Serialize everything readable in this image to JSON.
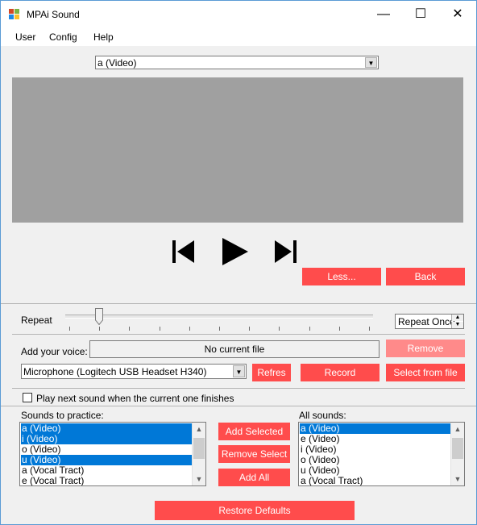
{
  "window": {
    "title": "MPAi Sound",
    "minimize": "—",
    "maximize": "☐",
    "close": "✕"
  },
  "menu": {
    "user": "User",
    "config": "Config",
    "help": "Help"
  },
  "video_select": {
    "value": "a (Video)"
  },
  "transport": {
    "prev": "skip-back",
    "play": "play",
    "next": "skip-forward"
  },
  "buttons": {
    "less": "Less...",
    "back": "Back",
    "remove": "Remove",
    "refresh": "Refres",
    "record": "Record",
    "select_from_file": "Select from file",
    "add_selected": "Add Selected",
    "remove_select": "Remove Select",
    "add_all": "Add All",
    "restore_defaults": "Restore Defaults"
  },
  "repeat": {
    "label": "Repeat",
    "slider_value_fraction": 0.1,
    "mode": "Repeat Once"
  },
  "voice": {
    "label": "Add your voice:",
    "file_status": "No current file",
    "microphone": "Microphone (Logitech USB Headset H340)"
  },
  "play_next": {
    "label": "Play next sound when the current one finishes",
    "checked": false
  },
  "practice": {
    "label": "Sounds to practice:",
    "items": [
      {
        "text": "a (Video)",
        "selected": true
      },
      {
        "text": "i (Video)",
        "selected": true
      },
      {
        "text": "o (Video)",
        "selected": false
      },
      {
        "text": "u (Video)",
        "selected": true
      },
      {
        "text": "a (Vocal Tract)",
        "selected": false
      },
      {
        "text": "e (Vocal Tract)",
        "selected": false
      }
    ]
  },
  "all_sounds": {
    "label": "All sounds:",
    "items": [
      {
        "text": "a (Video)",
        "selected": true
      },
      {
        "text": "e (Video)",
        "selected": false
      },
      {
        "text": "i (Video)",
        "selected": false
      },
      {
        "text": "o (Video)",
        "selected": false
      },
      {
        "text": "u (Video)",
        "selected": false
      },
      {
        "text": "a (Vocal Tract)",
        "selected": false
      }
    ]
  },
  "colors": {
    "accent_button": "#ff4c4c",
    "disabled_button": "#ff8a8a",
    "selection": "#0078d7",
    "video_area": "#a0a0a0"
  }
}
